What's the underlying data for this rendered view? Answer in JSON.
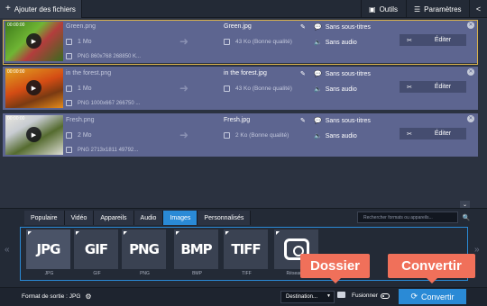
{
  "toolbar": {
    "add_files_label": "Ajouter des fichiers",
    "tools_label": "Outils",
    "settings_label": "Paramètres"
  },
  "files": [
    {
      "timecode": "00:00:00",
      "source_name": "Green.png",
      "source_size": "1 Mo",
      "source_info": "PNG 860x768 268850 K...",
      "output_name": "Green.jpg",
      "output_size": "43 Ko (Bonne qualité)",
      "subtitles": "Sans sous-titres",
      "audio": "Sans audio",
      "edit_label": "Éditer",
      "selected": true
    },
    {
      "timecode": "00:00:00",
      "source_name": "in the forest.png",
      "source_size": "1 Mo",
      "source_info": "PNG 1000x667 266750 ...",
      "output_name": "in the forest.jpg",
      "output_size": "43 Ko (Bonne qualité)",
      "subtitles": "Sans sous-titres",
      "audio": "Sans audio",
      "edit_label": "Éditer",
      "selected": false
    },
    {
      "timecode": "00:00:00",
      "source_name": "Fresh.png",
      "source_size": "2 Mo",
      "source_info": "PNG 2713x1811 49792...",
      "output_name": "Fresh.jpg",
      "output_size": "2 Ko (Bonne qualité)",
      "subtitles": "Sans sous-titres",
      "audio": "Sans audio",
      "edit_label": "Éditer",
      "selected": false
    }
  ],
  "format_tabs": [
    {
      "label": "Populaire",
      "active": false
    },
    {
      "label": "Vidéo",
      "active": false
    },
    {
      "label": "Appareils",
      "active": false
    },
    {
      "label": "Audio",
      "active": false
    },
    {
      "label": "Images",
      "active": true
    },
    {
      "label": "Personnalisés",
      "active": false
    }
  ],
  "search": {
    "placeholder": "Rechercher formats ou appareils..."
  },
  "formats": [
    {
      "tile": "JPG",
      "caption": "JPG",
      "selected": true
    },
    {
      "tile": "GIF",
      "caption": "GIF",
      "selected": false
    },
    {
      "tile": "PNG",
      "caption": "PNG",
      "selected": false
    },
    {
      "tile": "BMP",
      "caption": "BMP",
      "selected": false
    },
    {
      "tile": "TIFF",
      "caption": "TIFF",
      "selected": false
    },
    {
      "tile": "",
      "caption": "Réseaux...",
      "selected": false
    }
  ],
  "bottom": {
    "output_format": "Format de sortie : JPG",
    "destination_label": "Destination...",
    "merge_label": "Fusionner",
    "convert_label": "Convertir"
  },
  "callouts": {
    "folder": "Dossier",
    "convert": "Convertir"
  },
  "colors": {
    "accent": "#2a8ad6",
    "row_bg": "#5d6590",
    "callout": "#f0705a",
    "selection_outline": "#d9b24c"
  }
}
